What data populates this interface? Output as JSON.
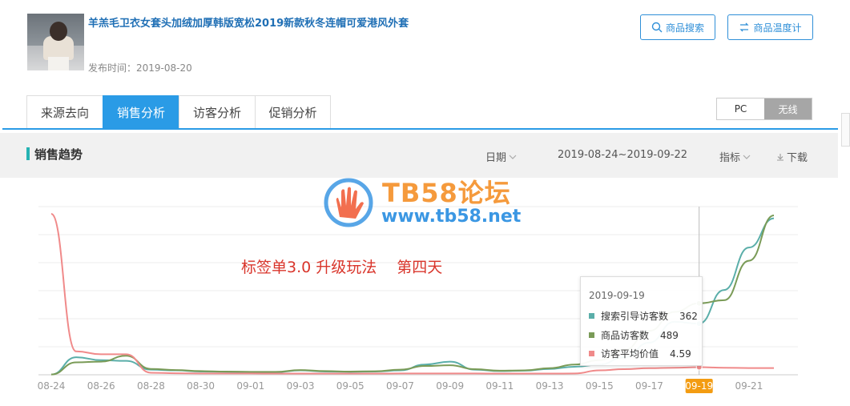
{
  "product": {
    "title": "羊羔毛卫衣女套头加绒加厚韩版宽松2019新款秋冬连帽可爱港风外套",
    "publish_label": "发布时间：2019-08-20"
  },
  "actions": {
    "search_label": "商品搜索",
    "temp_label": "商品温度计"
  },
  "tabs": [
    {
      "label": "来源去向",
      "active": false
    },
    {
      "label": "销售分析",
      "active": true
    },
    {
      "label": "访客分析",
      "active": false
    },
    {
      "label": "促销分析",
      "active": false
    }
  ],
  "device": {
    "pc": "PC",
    "wireless": "无线",
    "selected": "无线"
  },
  "trend": {
    "title": "销售趋势",
    "date_label": "日期",
    "date_range": "2019-08-24~2019-09-22",
    "metric_label": "指标",
    "download_label": "下载"
  },
  "watermark": {
    "title": "TB58论坛",
    "url": "www.tb58.net"
  },
  "annotation": "标签单3.0 升级玩法　 第四天",
  "tooltip": {
    "date": "2019-09-19",
    "rows": [
      {
        "label": "搜索引导访客数",
        "value": "362",
        "color": "#5aaea9"
      },
      {
        "label": "商品访客数",
        "value": "489",
        "color": "#7a9b57"
      },
      {
        "label": "访客平均价值",
        "value": "4.59",
        "color": "#f08a8a"
      }
    ]
  },
  "chart_data": {
    "type": "line",
    "x": [
      "08-24",
      "08-25",
      "08-26",
      "08-27",
      "08-28",
      "08-29",
      "08-30",
      "08-31",
      "09-01",
      "09-02",
      "09-03",
      "09-04",
      "09-05",
      "09-06",
      "09-07",
      "09-08",
      "09-09",
      "09-10",
      "09-11",
      "09-12",
      "09-13",
      "09-14",
      "09-15",
      "09-16",
      "09-17",
      "09-18",
      "09-19",
      "09-20",
      "09-21",
      "09-22"
    ],
    "tick_labels": [
      "08-24",
      "08-26",
      "08-28",
      "08-30",
      "09-01",
      "09-03",
      "09-05",
      "09-07",
      "09-09",
      "09-11",
      "09-13",
      "09-15",
      "09-17",
      "09-19",
      "09-21"
    ],
    "highlight_x": "09-19",
    "grid": true,
    "series": [
      {
        "name": "搜索引导访客数",
        "color": "#5aaea9",
        "values": [
          2,
          120,
          100,
          95,
          35,
          30,
          22,
          20,
          18,
          18,
          30,
          22,
          20,
          22,
          30,
          70,
          90,
          35,
          25,
          28,
          40,
          55,
          70,
          120,
          220,
          362,
          350,
          580,
          870,
          1070
        ]
      },
      {
        "name": "商品访客数",
        "color": "#7a9b57",
        "values": [
          2,
          85,
          90,
          130,
          40,
          32,
          25,
          22,
          20,
          20,
          32,
          25,
          22,
          24,
          35,
          60,
          65,
          38,
          28,
          30,
          45,
          70,
          100,
          170,
          300,
          430,
          489,
          510,
          780,
          1090
        ]
      },
      {
        "name": "访客平均价值",
        "color": "#f08a8a",
        "values": [
          1100,
          160,
          140,
          140,
          14,
          10,
          9,
          9,
          9,
          8,
          8,
          8,
          8,
          8,
          9,
          9,
          9,
          9,
          8,
          8,
          8,
          9,
          30,
          38,
          45,
          48,
          52,
          48,
          46,
          46
        ]
      }
    ]
  }
}
